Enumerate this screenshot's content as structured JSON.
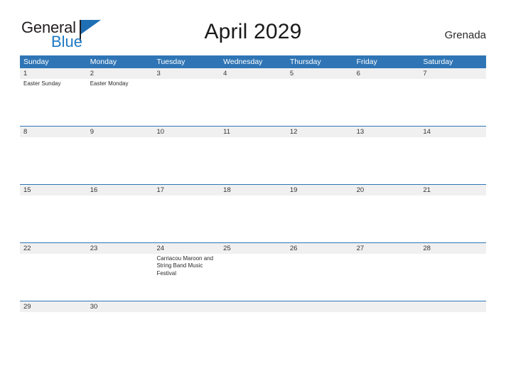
{
  "brand": {
    "line1": "General",
    "line2": "Blue",
    "flag_icon": "blue-triangle-icon"
  },
  "header": {
    "title": "April 2029",
    "locale": "Grenada"
  },
  "colors": {
    "header_blue": "#2f75b5",
    "band_gray": "#f0f0f0",
    "brand_blue": "#1f7ac4",
    "text": "#2b2b2b"
  },
  "calendar": {
    "weekdays": [
      "Sunday",
      "Monday",
      "Tuesday",
      "Wednesday",
      "Thursday",
      "Friday",
      "Saturday"
    ],
    "weeks": [
      {
        "height": "tall",
        "days": [
          {
            "number": "1",
            "events": [
              "Easter Sunday"
            ]
          },
          {
            "number": "2",
            "events": [
              "Easter Monday"
            ]
          },
          {
            "number": "3",
            "events": []
          },
          {
            "number": "4",
            "events": []
          },
          {
            "number": "5",
            "events": []
          },
          {
            "number": "6",
            "events": []
          },
          {
            "number": "7",
            "events": []
          }
        ]
      },
      {
        "height": "tall",
        "days": [
          {
            "number": "8",
            "events": []
          },
          {
            "number": "9",
            "events": []
          },
          {
            "number": "10",
            "events": []
          },
          {
            "number": "11",
            "events": []
          },
          {
            "number": "12",
            "events": []
          },
          {
            "number": "13",
            "events": []
          },
          {
            "number": "14",
            "events": []
          }
        ]
      },
      {
        "height": "tall",
        "days": [
          {
            "number": "15",
            "events": []
          },
          {
            "number": "16",
            "events": []
          },
          {
            "number": "17",
            "events": []
          },
          {
            "number": "18",
            "events": []
          },
          {
            "number": "19",
            "events": []
          },
          {
            "number": "20",
            "events": []
          },
          {
            "number": "21",
            "events": []
          }
        ]
      },
      {
        "height": "tall",
        "days": [
          {
            "number": "22",
            "events": []
          },
          {
            "number": "23",
            "events": []
          },
          {
            "number": "24",
            "events": [
              "Carriacou Maroon and String Band Music Festival"
            ]
          },
          {
            "number": "25",
            "events": []
          },
          {
            "number": "26",
            "events": []
          },
          {
            "number": "27",
            "events": []
          },
          {
            "number": "28",
            "events": []
          }
        ]
      },
      {
        "height": "short",
        "days": [
          {
            "number": "29",
            "events": []
          },
          {
            "number": "30",
            "events": []
          },
          {
            "number": "",
            "events": []
          },
          {
            "number": "",
            "events": []
          },
          {
            "number": "",
            "events": []
          },
          {
            "number": "",
            "events": []
          },
          {
            "number": "",
            "events": []
          }
        ]
      }
    ]
  }
}
